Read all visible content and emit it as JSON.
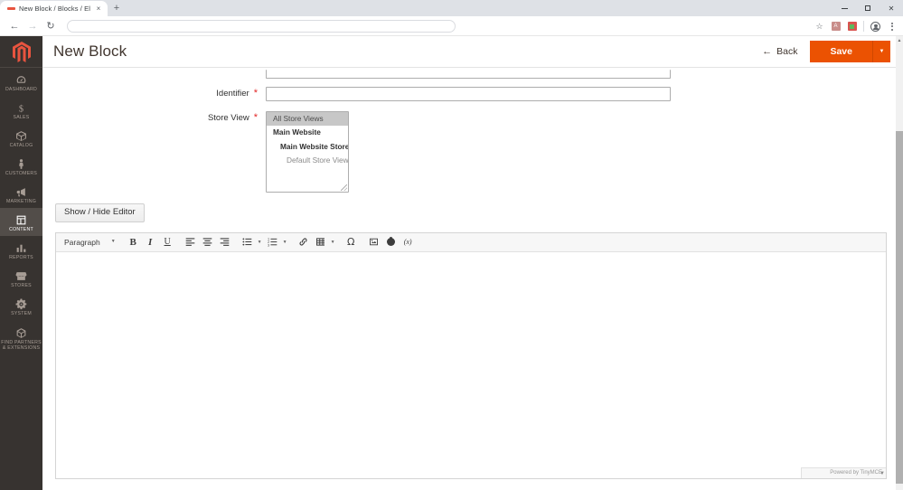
{
  "browser": {
    "tab": {
      "title": "New Block / Blocks / Elements /",
      "close_label": "×"
    },
    "new_tab_label": "+",
    "nav": {
      "back": "←",
      "forward": "→",
      "reload": "↻"
    },
    "url_value": "",
    "url_placeholder": "",
    "toolbar_icons": {
      "bookmark": "☆",
      "extension_pdf": "A",
      "extension_two": "",
      "profile": "profile",
      "menu": "menu"
    },
    "window": {
      "minimize": "─",
      "maximize": "□",
      "close": "✕"
    }
  },
  "sidebar": {
    "logo_alt": "Magento",
    "items": [
      {
        "label": "Dashboard",
        "icon": "gauge-icon",
        "active": false
      },
      {
        "label": "Sales",
        "icon": "dollar-icon",
        "active": false
      },
      {
        "label": "Catalog",
        "icon": "box-icon",
        "active": false
      },
      {
        "label": "Customers",
        "icon": "person-icon",
        "active": false
      },
      {
        "label": "Marketing",
        "icon": "megaphone-icon",
        "active": false
      },
      {
        "label": "Content",
        "icon": "layout-icon",
        "active": true
      },
      {
        "label": "Reports",
        "icon": "bar-chart-icon",
        "active": false
      },
      {
        "label": "Stores",
        "icon": "storefront-icon",
        "active": false
      },
      {
        "label": "System",
        "icon": "gear-icon",
        "active": false
      },
      {
        "label": "Find Partners & Extensions",
        "icon": "cube-icon",
        "active": false
      }
    ]
  },
  "header": {
    "title": "New Block",
    "back_label": "Back",
    "save_label": "Save",
    "save_caret": "▼"
  },
  "form": {
    "title_field": {
      "label": "",
      "value": "",
      "required": false
    },
    "identifier": {
      "label": "Identifier",
      "value": "",
      "required": true,
      "required_mark": "*"
    },
    "store_view": {
      "label": "Store View",
      "required": true,
      "required_mark": "*",
      "options": [
        {
          "label": "All Store Views",
          "level": 0,
          "selected": true
        },
        {
          "label": "Main Website",
          "level": 1,
          "selected": false
        },
        {
          "label": "Main Website Store",
          "level": 2,
          "selected": false
        },
        {
          "label": "Default Store View",
          "level": 3,
          "selected": false
        }
      ]
    }
  },
  "editor": {
    "show_hide_label": "Show / Hide Editor",
    "toolbar": {
      "format_select": "Paragraph",
      "format_caret": "▼",
      "buttons": [
        {
          "name": "bold",
          "glyph": "B"
        },
        {
          "name": "italic",
          "glyph": "I"
        },
        {
          "name": "underline",
          "glyph": "U"
        },
        {
          "name": "align-left",
          "glyph": ""
        },
        {
          "name": "align-center",
          "glyph": ""
        },
        {
          "name": "align-right",
          "glyph": ""
        },
        {
          "name": "bullet-list",
          "glyph": ""
        },
        {
          "name": "numbered-list",
          "glyph": ""
        },
        {
          "name": "link",
          "glyph": ""
        },
        {
          "name": "table",
          "glyph": ""
        },
        {
          "name": "special-character",
          "glyph": "Ω"
        },
        {
          "name": "insert-image",
          "glyph": ""
        },
        {
          "name": "insert-widget",
          "glyph": ""
        },
        {
          "name": "insert-variable",
          "glyph": "(x)"
        }
      ]
    },
    "content": "",
    "status_text": "Powered by TinyMCE"
  }
}
